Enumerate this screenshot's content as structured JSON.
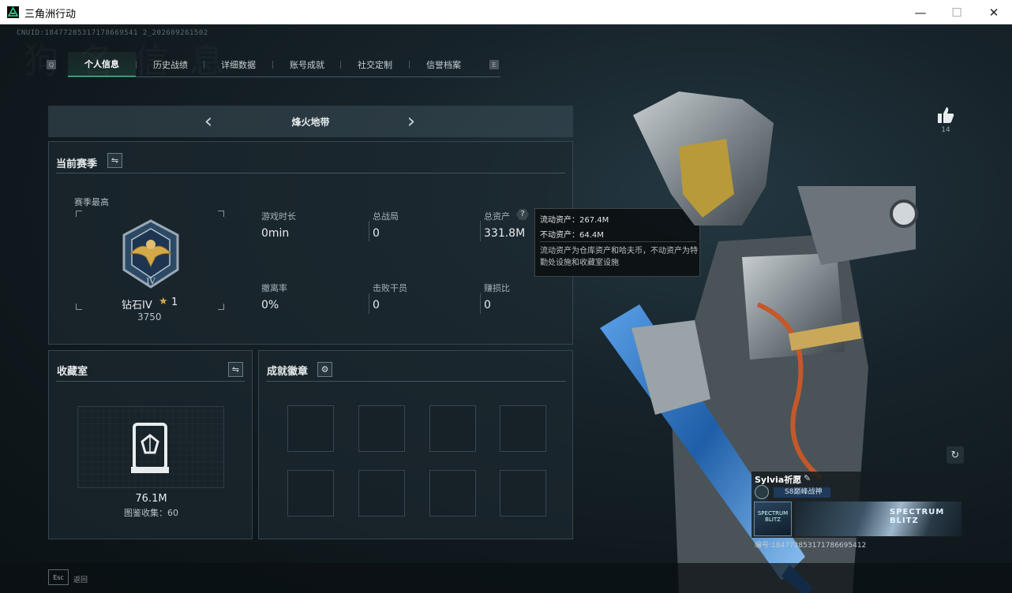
{
  "window": {
    "title": "三角洲行动",
    "minimize": "—",
    "maximize": "☐",
    "close": "✕"
  },
  "header": {
    "uid": "CNUID:18477285317178669541 2_202609261502",
    "bg_text": "狗 名 信 息"
  },
  "tabs": {
    "left_key": "Q",
    "right_key": "E",
    "items": [
      {
        "label": "个人信息",
        "active": true
      },
      {
        "label": "历史战绩",
        "active": false
      },
      {
        "label": "详细数据",
        "active": false
      },
      {
        "label": "账号成就",
        "active": false
      },
      {
        "label": "社交定制",
        "active": false
      },
      {
        "label": "信誉档案",
        "active": false
      }
    ]
  },
  "map_selector": {
    "label": "烽火地带",
    "prev_icon": "chevron-left-icon",
    "next_icon": "chevron-right-icon"
  },
  "season": {
    "title": "当前赛季",
    "toggle_icon": "swap-icon",
    "best_label": "赛季最高",
    "rank_name": "钻石IV",
    "rank_stars": "1",
    "rank_score": "3750",
    "stats": [
      {
        "label": "游戏时长",
        "value": "0min"
      },
      {
        "label": "总战局",
        "value": "0"
      },
      {
        "label": "总资产",
        "value": "331.8M",
        "has_help": true
      },
      {
        "label": "撤离率",
        "value": "0%"
      },
      {
        "label": "击败干员",
        "value": "0"
      },
      {
        "label": "赚损比",
        "value": "0"
      }
    ]
  },
  "tooltip": {
    "line1": "流动资产：267.4M",
    "line2": "不动资产：64.4M",
    "desc": "流动资产为仓库资产和哈夫币，不动资产为特勤处设施和收藏室设施"
  },
  "collection": {
    "title": "收藏室",
    "toggle_icon": "swap-icon",
    "value": "76.1M",
    "count_label": "图鉴收集：60"
  },
  "achievements": {
    "title": "成就徽章",
    "settings_icon": "gear-icon",
    "slots": 8
  },
  "social": {
    "like_icon": "thumbs-up-icon",
    "like_count": "14",
    "refresh_icon": "refresh-icon"
  },
  "card": {
    "name": "Sylvia祈愿",
    "edit_icon": "pencil-icon",
    "rank": "S8巅峰战神",
    "banner_text": "SPECTRUM BLITZ",
    "small_text": "SPECTRUM BLITZ",
    "id_label": "编号:184772853171786695412"
  },
  "footer": {
    "esc_key": "Esc",
    "esc_label": "返回"
  },
  "colors": {
    "accent": "#2fd38c",
    "panel": "#1c282f",
    "titlebar": "#ffffff"
  }
}
